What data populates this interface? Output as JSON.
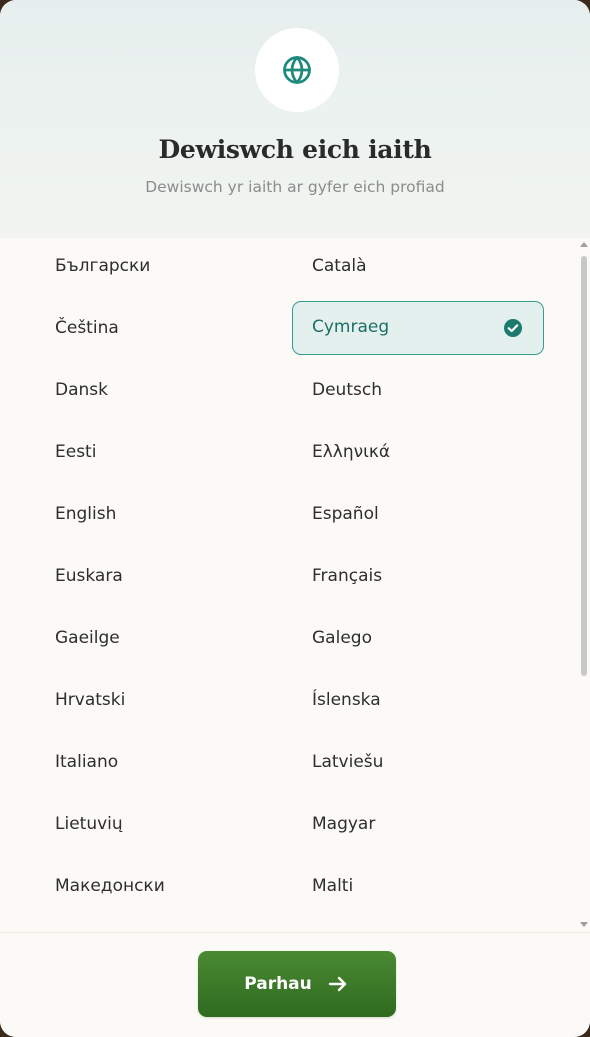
{
  "header": {
    "icon": "globe-icon",
    "title": "Dewiswch eich iaith",
    "subtitle": "Dewiswch yr iaith ar gyfer eich profiad"
  },
  "languages": [
    {
      "label": "Български",
      "selected": false
    },
    {
      "label": "Català",
      "selected": false
    },
    {
      "label": "Čeština",
      "selected": false
    },
    {
      "label": "Cymraeg",
      "selected": true
    },
    {
      "label": "Dansk",
      "selected": false
    },
    {
      "label": "Deutsch",
      "selected": false
    },
    {
      "label": "Eesti",
      "selected": false
    },
    {
      "label": "Ελληνικά",
      "selected": false
    },
    {
      "label": "English",
      "selected": false
    },
    {
      "label": "Español",
      "selected": false
    },
    {
      "label": "Euskara",
      "selected": false
    },
    {
      "label": "Français",
      "selected": false
    },
    {
      "label": "Gaeilge",
      "selected": false
    },
    {
      "label": "Galego",
      "selected": false
    },
    {
      "label": "Hrvatski",
      "selected": false
    },
    {
      "label": "Íslenska",
      "selected": false
    },
    {
      "label": "Italiano",
      "selected": false
    },
    {
      "label": "Latviešu",
      "selected": false
    },
    {
      "label": "Lietuvių",
      "selected": false
    },
    {
      "label": "Magyar",
      "selected": false
    },
    {
      "label": "Македонски",
      "selected": false
    },
    {
      "label": "Malti",
      "selected": false
    }
  ],
  "footer": {
    "continue_label": "Parhau",
    "continue_icon": "arrow-right-icon"
  },
  "colors": {
    "accent_teal": "#1d8a7c",
    "button_green": "#3a7a28",
    "selected_bg": "#e3f0ee"
  }
}
